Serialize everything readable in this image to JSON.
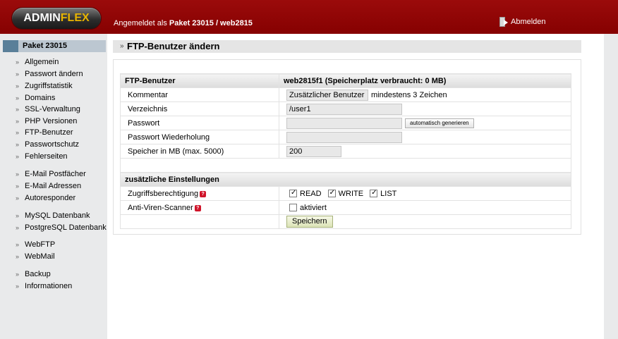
{
  "header": {
    "logo_part1": "ADMIN",
    "logo_part2": "FLEX",
    "login_prefix": "Angemeldet als",
    "login_user": "Paket 23015 / web2815",
    "logout_label": "Abmelden"
  },
  "sidebar": {
    "title": "Paket 23015",
    "items": [
      {
        "label": "Allgemein"
      },
      {
        "label": "Passwort ändern"
      },
      {
        "label": "Zugriffstatistik"
      },
      {
        "label": "Domains"
      },
      {
        "label": "SSL-Verwaltung"
      },
      {
        "label": "PHP Versionen"
      },
      {
        "label": "FTP-Benutzer"
      },
      {
        "label": "Passwortschutz"
      },
      {
        "label": "Fehlerseiten"
      },
      {
        "label": "E-Mail Postfächer"
      },
      {
        "label": "E-Mail Adressen"
      },
      {
        "label": "Autoresponder"
      },
      {
        "label": "MySQL Datenbank"
      },
      {
        "label": "PostgreSQL Datenbank"
      },
      {
        "label": "WebFTP"
      },
      {
        "label": "WebMail"
      },
      {
        "label": "Backup"
      },
      {
        "label": "Informationen"
      }
    ]
  },
  "page": {
    "title": "FTP-Benutzer ändern"
  },
  "form": {
    "header_label": "FTP-Benutzer",
    "header_value": "web2815f1 (Speicherplatz verbraucht: 0 MB)",
    "comment_label": "Kommentar",
    "comment_value": "Zusätzlicher Benutzer",
    "comment_hint": "mindestens 3 Zeichen",
    "directory_label": "Verzeichnis",
    "directory_value": "/user1",
    "password_label": "Passwort",
    "password_value": "",
    "generate_button": "automatisch generieren",
    "password_repeat_label": "Passwort Wiederholung",
    "password_repeat_value": "",
    "storage_label": "Speicher in MB (max. 5000)",
    "storage_value": "200",
    "extra_section": "zusätzliche Einstellungen",
    "access_label": "Zugriffsberechtigung",
    "read_label": "READ",
    "write_label": "WRITE",
    "list_label": "LIST",
    "antivirus_label": "Anti-Viren-Scanner",
    "antivirus_option": "aktiviert",
    "save_button": "Speichern",
    "help_glyph": "?"
  }
}
